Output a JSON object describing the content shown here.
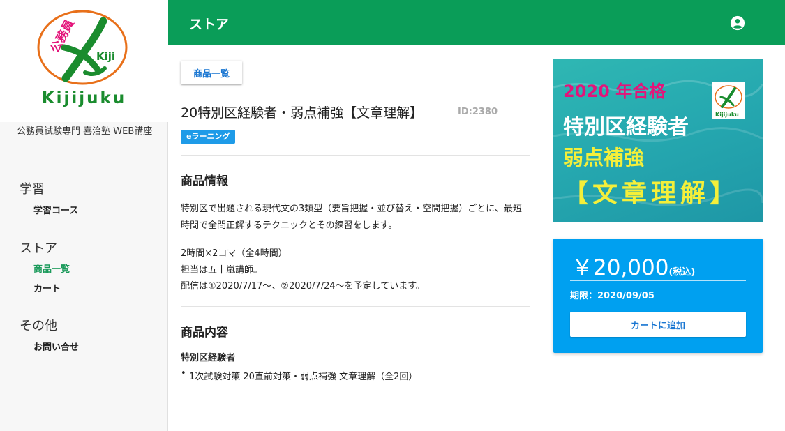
{
  "sidebar": {
    "logo_text": "Kijijuku",
    "logo_badge": "公務員",
    "site_name": "公務員試験専門 喜治塾 WEB講座",
    "groups": [
      {
        "title": "学習",
        "items": [
          {
            "label": "学習コース",
            "active": false
          }
        ]
      },
      {
        "title": "ストア",
        "items": [
          {
            "label": "商品一覧",
            "active": true
          },
          {
            "label": "カート",
            "active": false
          }
        ]
      },
      {
        "title": "その他",
        "items": [
          {
            "label": "お問い合せ",
            "active": false
          }
        ]
      }
    ]
  },
  "header": {
    "title": "ストア",
    "account_icon": "account-circle-icon"
  },
  "main": {
    "back_button": "商品一覧",
    "product_title": "20特別区経験者・弱点補強【文章理解】",
    "product_id": "ID:2380",
    "badge": "eラーニング",
    "info_heading": "商品情報",
    "description_1": "特別区で出題される現代文の3類型（要旨把握・並び替え・空間把握）ごとに、最短時間で全問正解するテクニックとその練習をします。",
    "description_2": "2時間×2コマ（全4時間）",
    "description_3": "担当は五十嵐講師。",
    "description_4": "配信は①2020/7/17～、②2020/7/24～を予定しています。",
    "content_heading": "商品内容",
    "content_subheading": "特別区経験者",
    "content_item": "1次試験対策 20直前対策・弱点補強 文章理解（全2回）"
  },
  "banner": {
    "year_line": "2020 年合格",
    "line1": "特別区経験者",
    "line2": "弱点補強",
    "line3": "【文章理解】"
  },
  "price_card": {
    "price": "￥20,000",
    "tax_note": "(税込)",
    "deadline": "期限：2020/09/05",
    "cart_button": "カートに追加"
  },
  "colors": {
    "header_bg": "#0a9d58",
    "accent_green": "#1a9a5a",
    "price_card_bg": "#00a0f0",
    "link_blue": "#1976d2"
  }
}
